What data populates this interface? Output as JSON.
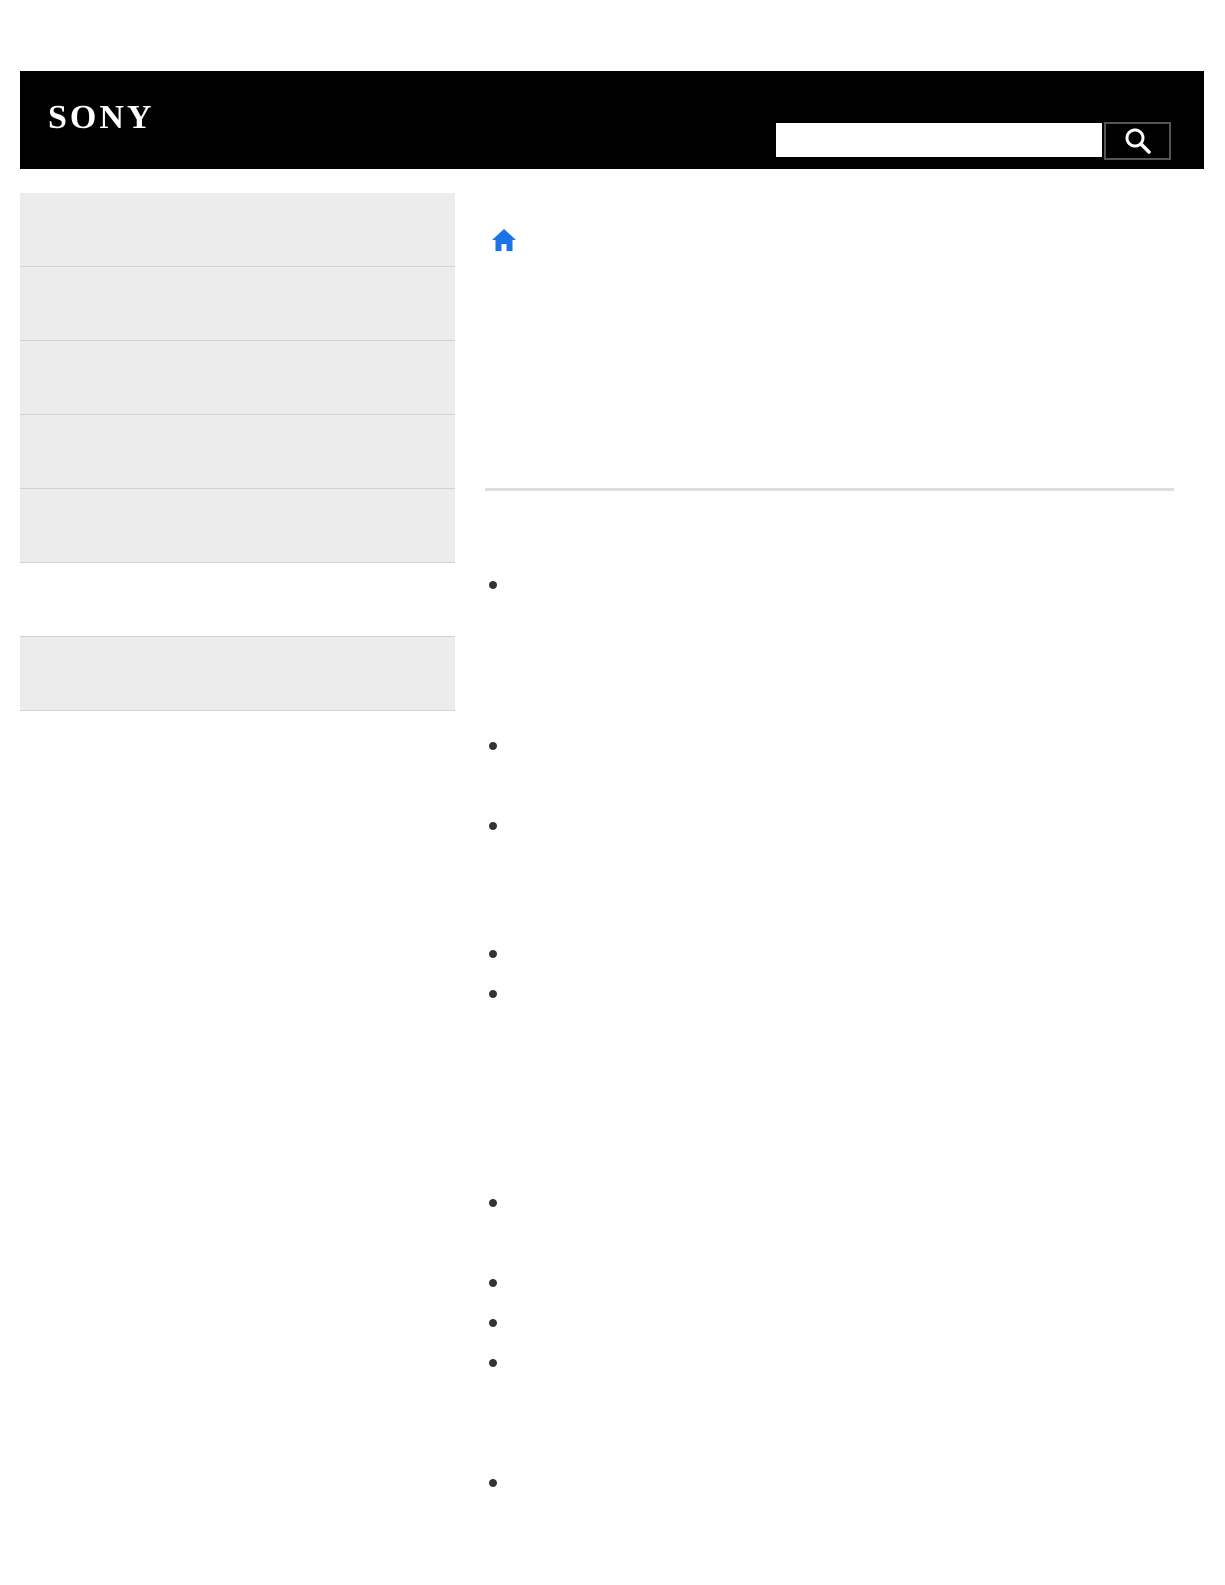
{
  "header": {
    "brand": "SONY",
    "search_placeholder": "",
    "search_value": "",
    "search_button_icon": "search-icon"
  },
  "sidebar": {
    "items": [
      {
        "label": ""
      },
      {
        "label": ""
      },
      {
        "label": ""
      },
      {
        "label": ""
      },
      {
        "label": ""
      },
      {
        "label": ""
      }
    ]
  },
  "breadcrumb": {
    "home_icon": "home-icon",
    "home_color": "#1a73e8"
  },
  "main": {
    "title": "",
    "bullets": [
      {
        "text": ""
      },
      {
        "text": ""
      },
      {
        "text": ""
      },
      {
        "text": ""
      },
      {
        "text": ""
      },
      {
        "text": ""
      },
      {
        "text": ""
      },
      {
        "text": ""
      },
      {
        "text": ""
      },
      {
        "text": ""
      }
    ]
  }
}
